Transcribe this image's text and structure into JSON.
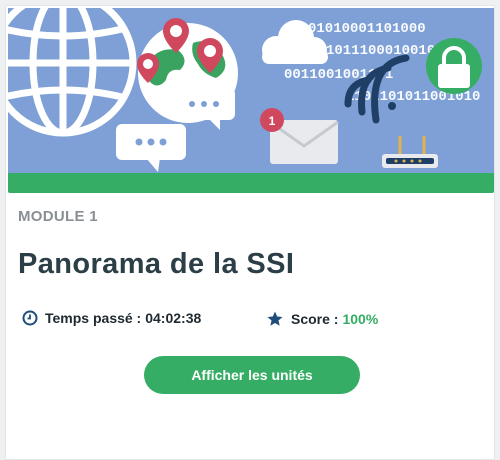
{
  "module": {
    "label": "MODULE 1",
    "title": "Panorama de la SSI",
    "time_label": "Temps passé :",
    "time_value": "04:02:38",
    "score_label": "Score :",
    "score_value": "100%",
    "button_label": "Afficher les unités"
  },
  "banner": {
    "binary_lines": [
      "01010001101000",
      "1011100010010",
      "0011001001101",
      "1101101011001010"
    ],
    "notification_count": "1",
    "icons": [
      "globe-icon",
      "map-pin-icon",
      "chat-bubble-icon",
      "cloud-icon",
      "wifi-icon",
      "padlock-icon",
      "envelope-icon",
      "router-icon"
    ]
  },
  "colors": {
    "banner_bg": "#7ea0d6",
    "accent_green": "#35ad64",
    "title_text": "#2c3e46",
    "module_label": "#8a8f93",
    "time_icon": "#1e4d7a",
    "star_icon": "#1e4d7a",
    "pin_red": "#d0485e"
  }
}
